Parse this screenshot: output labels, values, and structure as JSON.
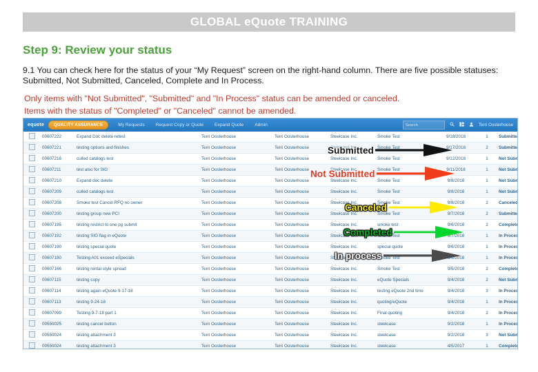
{
  "banner": {
    "title": "GLOBAL eQuote TRAINING"
  },
  "heading": "Step 9: Review your status",
  "body": {
    "paragraph_1": "9.1  You can check here for the status of your  “My Request”  screen on the right-hand column.  There are five possible statuses: Submitted, Not Submitted, Canceled, Complete and In Process.",
    "note_line_1": "Only items with \"Not Submitted\", \"Submitted\" and \"In Process\" status can be amended or canceled.",
    "note_line_2": "Items with the status of \"Completed\" or \"Canceled\" cannot be amended."
  },
  "app": {
    "nav": {
      "logo": "equote",
      "badge": "QUALITY ASSURANCE",
      "items": [
        {
          "label": "My Requests"
        },
        {
          "label": "Request Copy or Quote"
        },
        {
          "label": "Expand Quote"
        },
        {
          "label": "Admin"
        }
      ],
      "search_placeholder": "Search",
      "search_value": "",
      "user": "Terri Oosterhouse"
    },
    "rows": [
      {
        "id": "00607222",
        "desc": "Expand Doc delete retest",
        "owner": "Terri Oosterhouse",
        "requester": "Terri Oosterhouse",
        "company": "Steelcase Inc.",
        "project": "Smoke Test",
        "date": "9/18/2018",
        "num": "1",
        "status": "Submitted",
        "status_class": "st-sub"
      },
      {
        "id": "00607221",
        "desc": "testing options and finishes",
        "owner": "Terri Oosterhouse",
        "requester": "Terri Oosterhouse",
        "company": "Steelcase Inc.",
        "project": "Smoke Test",
        "date": "9/17/2018",
        "num": "2",
        "status": "Submitted",
        "status_class": "st-sub"
      },
      {
        "id": "00607216",
        "desc": "culled catalogs test",
        "owner": "Terri Oosterhouse",
        "requester": "Terri Oosterhouse",
        "company": "Steelcase Inc.",
        "project": "Smoke Test",
        "date": "9/12/2018",
        "num": "1",
        "status": "Not Submitted",
        "status_class": "st-not"
      },
      {
        "id": "00607211",
        "desc": "test also for SIG",
        "owner": "Terri Oosterhouse",
        "requester": "Terri Oosterhouse",
        "company": "Steelcase Inc.",
        "project": "Smoke Test",
        "date": "9/11/2018",
        "num": "1",
        "status": "Not Submitted",
        "status_class": "st-not"
      },
      {
        "id": "00607210",
        "desc": "Expand doc delete",
        "owner": "Terri Oosterhouse",
        "requester": "Terri Oosterhouse",
        "company": "Steelcase Inc.",
        "project": "Smoke Test",
        "date": "9/8/2018",
        "num": "1",
        "status": "Not Submitted",
        "status_class": "st-not"
      },
      {
        "id": "00607209",
        "desc": "culled catalogs test",
        "owner": "Terri Oosterhouse",
        "requester": "Terri Oosterhouse",
        "company": "Steelcase Inc.",
        "project": "Smoke Test",
        "date": "9/8/2018",
        "num": "1",
        "status": "Not Submitted",
        "status_class": "st-not"
      },
      {
        "id": "00607208",
        "desc": "Smoke test Cancel RFQ no owner",
        "owner": "Terri Oosterhouse",
        "requester": "Terri Oosterhouse",
        "company": "Steelcase Inc.",
        "project": "Smoke Test",
        "date": "9/8/2018",
        "num": "2",
        "status": "Canceled",
        "status_class": "st-can"
      },
      {
        "id": "00607200",
        "desc": "testing group new PCI",
        "owner": "Terri Oosterhouse",
        "requester": "Terri Oosterhouse",
        "company": "Steelcase Inc.",
        "project": "Smoke Test",
        "date": "9/7/2018",
        "num": "2",
        "status": "Submitted",
        "status_class": "st-sub"
      },
      {
        "id": "00607195",
        "desc": "testing restrict to one pg submit",
        "owner": "Terri Oosterhouse",
        "requester": "Terri Oosterhouse",
        "company": "Steelcase Inc.",
        "project": "smoke test",
        "date": "9/6/2018",
        "num": "2",
        "status": "Completed",
        "status_class": "st-comp"
      },
      {
        "id": "00607192",
        "desc": "testing SIG flag in eQuote",
        "owner": "Terri Oosterhouse",
        "requester": "Terri Oosterhouse",
        "company": "Steelcase Inc.",
        "project": "Smoke Test",
        "date": "9/7/2018",
        "num": "1",
        "status": "In Process",
        "status_class": "st-proc"
      },
      {
        "id": "00607190",
        "desc": "testing special quote",
        "owner": "Terri Oosterhouse",
        "requester": "Terri Oosterhouse",
        "company": "Steelcase Inc.",
        "project": "special quote",
        "date": "9/6/2018",
        "num": "1",
        "status": "In Process",
        "status_class": "st-proc"
      },
      {
        "id": "00607180",
        "desc": "Testing A01 exceed eSpecials",
        "owner": "Terri Oosterhouse",
        "requester": "Terri Oosterhouse",
        "company": "Steelcase Inc.",
        "project": "Smoke Test",
        "date": "9/6/2018",
        "num": "1",
        "status": "In Process",
        "status_class": "st-proc"
      },
      {
        "id": "00607166",
        "desc": "testing rental style spread",
        "owner": "Terri Oosterhouse",
        "requester": "Terri Oosterhouse",
        "company": "Steelcase Inc.",
        "project": "Smoke Test",
        "date": "9/5/2018",
        "num": "2",
        "status": "Completed",
        "status_class": "st-comp"
      },
      {
        "id": "00607115",
        "desc": "testing copy",
        "owner": "Terri Oosterhouse",
        "requester": "Terri Oosterhouse",
        "company": "Steelcase Inc.",
        "project": "eQuote Specials",
        "date": "9/4/2018",
        "num": "2",
        "status": "Not Submitted",
        "status_class": "st-not"
      },
      {
        "id": "00607114",
        "desc": "testing again eQuote 9-17-18",
        "owner": "Terri Oosterhouse",
        "requester": "Terri Oosterhouse",
        "company": "Steelcase Inc.",
        "project": "testing eQuote 2nd time",
        "date": "9/4/2018",
        "num": "3",
        "status": "In Process",
        "status_class": "st-proc"
      },
      {
        "id": "00607113",
        "desc": "testing 9-24-18",
        "owner": "Terri Oosterhouse",
        "requester": "Terri Oosterhouse",
        "company": "Steelcase Inc.",
        "project": "quoting/eQuote",
        "date": "9/4/2018",
        "num": "1",
        "status": "In Process",
        "status_class": "st-proc"
      },
      {
        "id": "00607099",
        "desc": "Testing 9-7-18 part 1",
        "owner": "Terri Oosterhouse",
        "requester": "Terri Oosterhouse",
        "company": "Steelcase Inc.",
        "project": "Final quoting",
        "date": "9/4/2018",
        "num": "2",
        "status": "In Process",
        "status_class": "st-proc"
      },
      {
        "id": "00550025",
        "desc": "testing cancel button",
        "owner": "Terri Oosterhouse",
        "requester": "Terri Oosterhouse",
        "company": "Steelcase Inc.",
        "project": "steelcase",
        "date": "9/2/2018",
        "num": "1",
        "status": "In Process",
        "status_class": "st-proc"
      },
      {
        "id": "00550024",
        "desc": "testing attachment 3",
        "owner": "Terri Oosterhouse",
        "requester": "Terri Oosterhouse",
        "company": "Steelcase Inc.",
        "project": "steelcase",
        "date": "9/2/2018",
        "num": "3",
        "status": "Not Submitted",
        "status_class": "st-not"
      },
      {
        "id": "00550024",
        "desc": "testing attachment 3",
        "owner": "Terri Oosterhouse",
        "requester": "Terri Oosterhouse",
        "company": "Steelcase Inc.",
        "project": "steelcase",
        "date": "4/5/2017",
        "num": "1",
        "status": "Completed",
        "status_class": "st-comp"
      }
    ]
  },
  "annotations": [
    {
      "label": "Submitted",
      "color": "#111111",
      "arrow_color": "#111111"
    },
    {
      "label": "Not Submitted",
      "color": "#e8341c",
      "arrow_color": "#f03c18"
    },
    {
      "label": "Canceled",
      "color": "#fff200",
      "arrow_color": "#ffeb00"
    },
    {
      "label": "Completed",
      "color": "#00b624",
      "arrow_color": "#00d62b"
    },
    {
      "label": "In process",
      "color": "#ffffff",
      "arrow_color": "#4a4a4a"
    }
  ]
}
